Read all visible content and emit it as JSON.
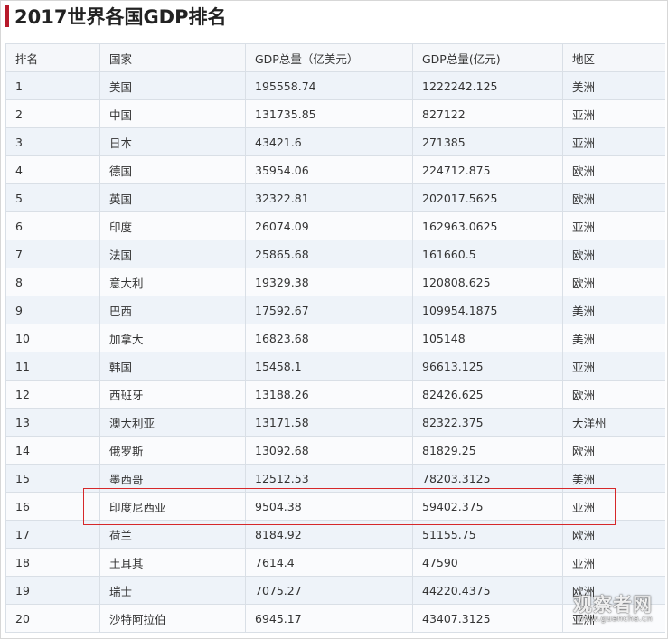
{
  "title": "2017世界各国GDP排名",
  "table": {
    "headers": [
      "排名",
      "国家",
      "GDP总量（亿美元）",
      "GDP总量(亿元)",
      "地区"
    ],
    "rows": [
      [
        "1",
        "美国",
        "195558.74",
        "1222242.125",
        "美洲"
      ],
      [
        "2",
        "中国",
        "131735.85",
        "827122",
        "亚洲"
      ],
      [
        "3",
        "日本",
        "43421.6",
        "271385",
        "亚洲"
      ],
      [
        "4",
        "德国",
        "35954.06",
        "224712.875",
        "欧洲"
      ],
      [
        "5",
        "英国",
        "32322.81",
        "202017.5625",
        "欧洲"
      ],
      [
        "6",
        "印度",
        "26074.09",
        "162963.0625",
        "亚洲"
      ],
      [
        "7",
        "法国",
        "25865.68",
        "161660.5",
        "欧洲"
      ],
      [
        "8",
        "意大利",
        "19329.38",
        "120808.625",
        "欧洲"
      ],
      [
        "9",
        "巴西",
        "17592.67",
        "109954.1875",
        "美洲"
      ],
      [
        "10",
        "加拿大",
        "16823.68",
        "105148",
        "美洲"
      ],
      [
        "11",
        "韩国",
        "15458.1",
        "96613.125",
        "亚洲"
      ],
      [
        "12",
        "西班牙",
        "13188.26",
        "82426.625",
        "欧洲"
      ],
      [
        "13",
        "澳大利亚",
        "13171.58",
        "82322.375",
        "大洋州"
      ],
      [
        "14",
        "俄罗斯",
        "13092.68",
        "81829.25",
        "欧洲"
      ],
      [
        "15",
        "墨西哥",
        "12512.53",
        "78203.3125",
        "美洲"
      ],
      [
        "16",
        "印度尼西亚",
        "9504.38",
        "59402.375",
        "亚洲"
      ],
      [
        "17",
        "荷兰",
        "8184.92",
        "51155.75",
        "欧洲"
      ],
      [
        "18",
        "土耳其",
        "7614.4",
        "47590",
        "亚洲"
      ],
      [
        "19",
        "瑞士",
        "7075.27",
        "44220.4375",
        "欧洲"
      ],
      [
        "20",
        "沙特阿拉伯",
        "6945.17",
        "43407.3125",
        "亚洲"
      ]
    ]
  },
  "watermark": {
    "main": "观察者网",
    "sub": "www.guancha.cn"
  },
  "colors": {
    "accent": "#b7192a",
    "highlight": "#d6282a",
    "row_odd": "#eef3f9",
    "row_even": "#fafbfd",
    "header_bg": "#f5f7fa",
    "border": "#d9dfe6"
  }
}
